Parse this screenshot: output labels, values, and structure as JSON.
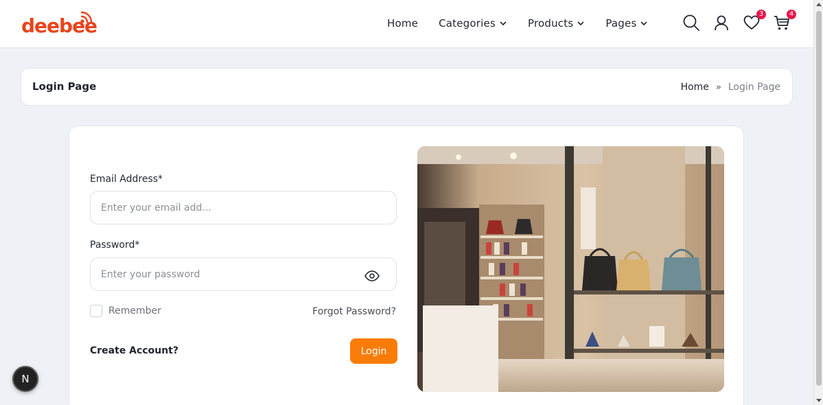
{
  "brand": {
    "name": "deebee",
    "color": "#e8451c"
  },
  "nav": {
    "items": [
      {
        "label": "Home",
        "dropdown": false
      },
      {
        "label": "Categories",
        "dropdown": true
      },
      {
        "label": "Products",
        "dropdown": true
      },
      {
        "label": "Pages",
        "dropdown": true
      }
    ]
  },
  "header_icons": {
    "search": "search-icon",
    "account": "user-icon",
    "wishlist": {
      "icon": "heart-icon",
      "count": "3"
    },
    "cart": {
      "icon": "cart-icon",
      "count": "4"
    }
  },
  "breadcrumb": {
    "title": "Login Page",
    "home": "Home",
    "current": "Login Page"
  },
  "login": {
    "email_label": "Email Address*",
    "email_placeholder": "Enter your email add...",
    "password_label": "Password*",
    "password_placeholder": "Enter your password",
    "remember_label": "Remember",
    "forgot_label": "Forgot Password?",
    "create_label": "Create Account?",
    "login_button": "Login",
    "accent_color": "#f97c08"
  },
  "floating_badge": "N",
  "colors": {
    "badge": "#e8174a",
    "background": "#eef1f5"
  }
}
